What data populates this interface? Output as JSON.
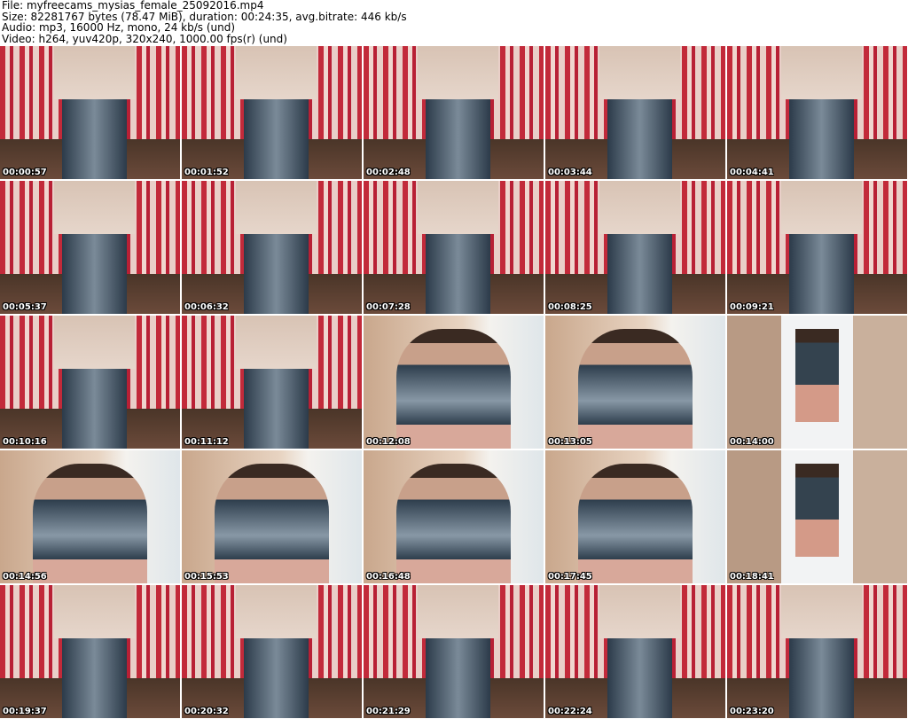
{
  "header": {
    "file": "File: myfreecams_mysias_female_25092016.mp4",
    "size": "Size: 82281767 bytes (78.47 MiB), duration: 00:24:35, avg.bitrate: 446 kb/s",
    "audio": "Audio: mp3, 16000 Hz, mono, 24 kb/s (und)",
    "video": "Video: h264, yuv420p, 320x240, 1000.00 fps(r) (und)"
  },
  "thumbnails": [
    {
      "time": "00:00:57",
      "scene": "curtain"
    },
    {
      "time": "00:01:52",
      "scene": "curtain"
    },
    {
      "time": "00:02:48",
      "scene": "curtain"
    },
    {
      "time": "00:03:44",
      "scene": "curtain"
    },
    {
      "time": "00:04:41",
      "scene": "curtain"
    },
    {
      "time": "00:05:37",
      "scene": "curtain"
    },
    {
      "time": "00:06:32",
      "scene": "curtain"
    },
    {
      "time": "00:07:28",
      "scene": "curtain"
    },
    {
      "time": "00:08:25",
      "scene": "curtain"
    },
    {
      "time": "00:09:21",
      "scene": "curtain"
    },
    {
      "time": "00:10:16",
      "scene": "curtain"
    },
    {
      "time": "00:11:12",
      "scene": "curtain"
    },
    {
      "time": "00:12:08",
      "scene": "wall"
    },
    {
      "time": "00:13:05",
      "scene": "wall"
    },
    {
      "time": "00:14:00",
      "scene": "window"
    },
    {
      "time": "00:14:56",
      "scene": "wall"
    },
    {
      "time": "00:15:53",
      "scene": "wall"
    },
    {
      "time": "00:16:48",
      "scene": "wall"
    },
    {
      "time": "00:17:45",
      "scene": "wall"
    },
    {
      "time": "00:18:41",
      "scene": "window"
    },
    {
      "time": "00:19:37",
      "scene": "curtain"
    },
    {
      "time": "00:20:32",
      "scene": "curtain"
    },
    {
      "time": "00:21:29",
      "scene": "curtain"
    },
    {
      "time": "00:22:24",
      "scene": "curtain"
    },
    {
      "time": "00:23:20",
      "scene": "curtain"
    }
  ]
}
